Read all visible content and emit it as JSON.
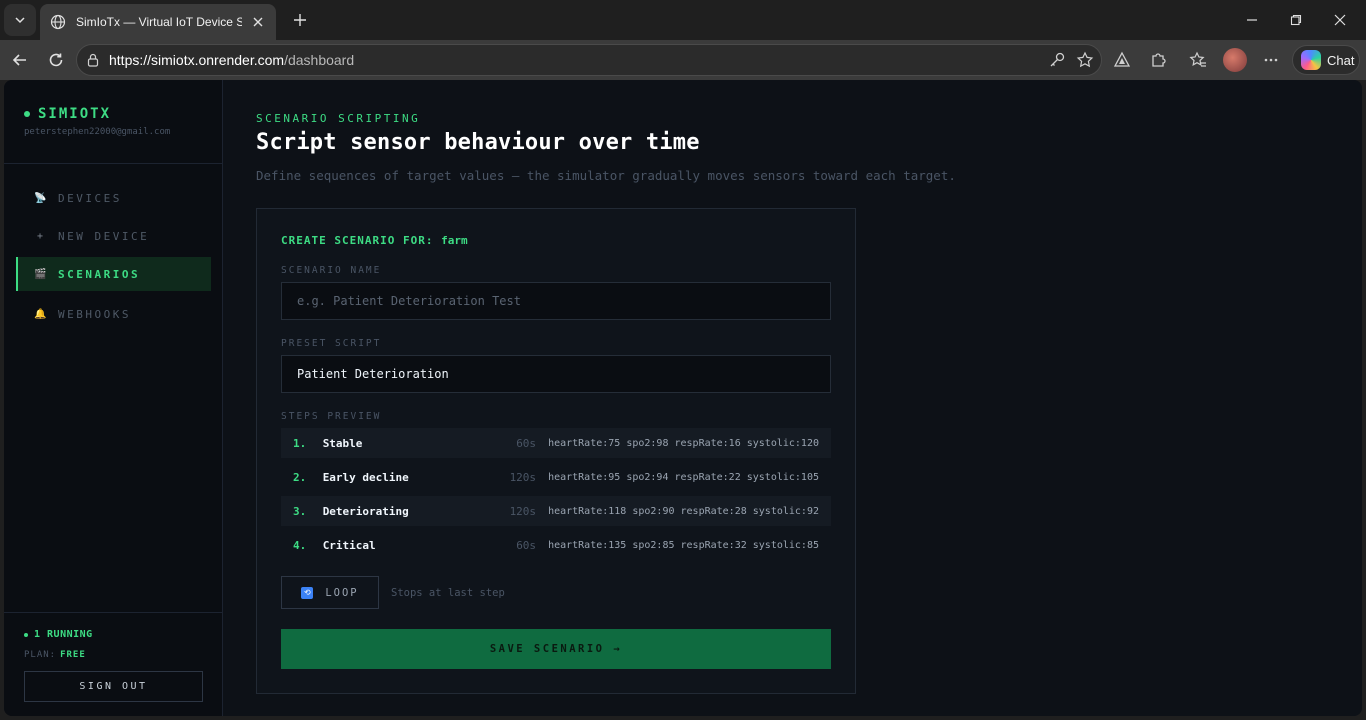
{
  "browser": {
    "tab_title": "SimIoTx — Virtual IoT Device Simu",
    "url_host": "https://simiotx.onrender.com",
    "url_path": "/dashboard",
    "chat_label": "Chat"
  },
  "sidebar": {
    "brand": "SIMIOTX",
    "email": "peterstephen22000@gmail.com",
    "items": [
      {
        "icon": "satellite-icon",
        "glyph": "📡",
        "label": "DEVICES",
        "active": false
      },
      {
        "icon": "plus-icon",
        "glyph": "+",
        "label": "NEW DEVICE",
        "active": false
      },
      {
        "icon": "clapper-icon",
        "glyph": "🎬",
        "label": "SCENARIOS",
        "active": true
      },
      {
        "icon": "bell-icon",
        "glyph": "🔔",
        "label": "WEBHOOKS",
        "active": false
      }
    ],
    "running": "1 RUNNING",
    "plan_label": "PLAN:",
    "plan_value": "FREE",
    "signout": "SIGN OUT"
  },
  "main": {
    "eyebrow": "SCENARIO SCRIPTING",
    "title": "Script sensor behaviour over time",
    "subtitle": "Define sequences of target values — the simulator gradually moves sensors toward each target.",
    "card": {
      "title_prefix": "CREATE SCENARIO FOR:",
      "device": "farm",
      "name_label": "SCENARIO NAME",
      "name_placeholder": "e.g. Patient Deterioration Test",
      "preset_label": "PRESET SCRIPT",
      "preset_value": "Patient Deterioration",
      "steps_label": "STEPS PREVIEW",
      "steps": [
        {
          "num": "1.",
          "name": "Stable",
          "duration": "60s",
          "values": "heartRate:75 spo2:98 respRate:16 systolic:120"
        },
        {
          "num": "2.",
          "name": "Early decline",
          "duration": "120s",
          "values": "heartRate:95 spo2:94 respRate:22 systolic:105"
        },
        {
          "num": "3.",
          "name": "Deteriorating",
          "duration": "120s",
          "values": "heartRate:118 spo2:90 respRate:28 systolic:92"
        },
        {
          "num": "4.",
          "name": "Critical",
          "duration": "60s",
          "values": "heartRate:135 spo2:85 respRate:32 systolic:85"
        }
      ],
      "loop_label": "LOOP",
      "loop_note": "Stops at last step",
      "save_label": "SAVE SCENARIO →"
    }
  },
  "colors": {
    "accent": "#3ddc84",
    "background": "#0d1117",
    "save_button": "#0f6b40"
  }
}
